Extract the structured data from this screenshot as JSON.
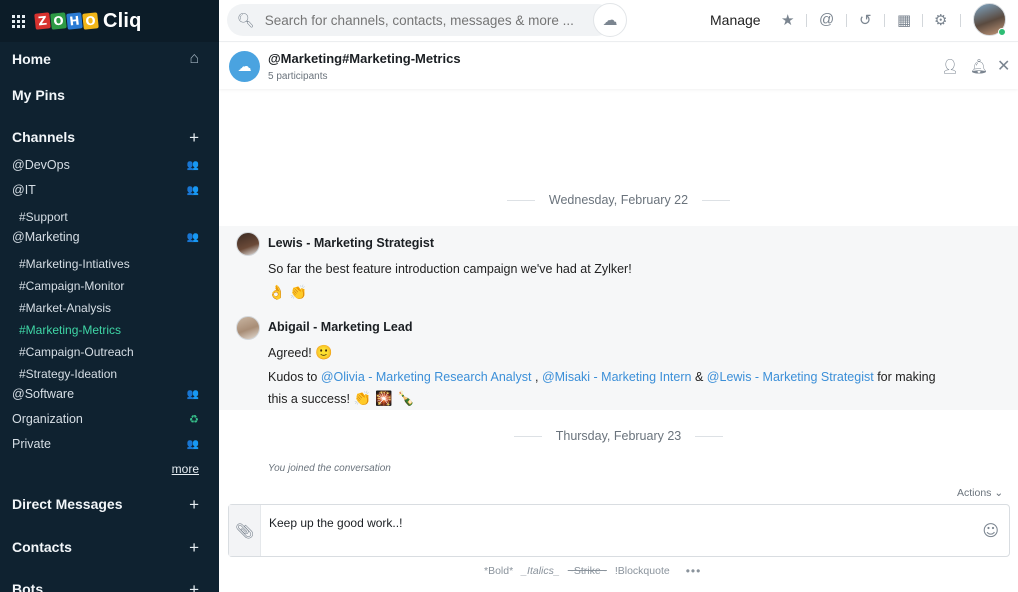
{
  "brand": {
    "letters": [
      "Z",
      "O",
      "H",
      "O"
    ],
    "letter_colors": [
      "#d8322f",
      "#2e9a45",
      "#2a7bd4",
      "#f2b619"
    ],
    "product": "Cliq"
  },
  "sidebar": {
    "home": "Home",
    "pins": "My Pins",
    "channels_title": "Channels",
    "channels": [
      {
        "label": "@DevOps",
        "icon": "group-icon"
      },
      {
        "label": "@IT",
        "icon": "group-icon"
      },
      {
        "label": "#Support",
        "sub": true
      },
      {
        "label": "@Marketing",
        "icon": "group-icon"
      },
      {
        "label": "#Marketing-Intiatives",
        "sub": true
      },
      {
        "label": "#Campaign-Monitor",
        "sub": true
      },
      {
        "label": "#Market-Analysis",
        "sub": true
      },
      {
        "label": "#Marketing-Metrics",
        "sub": true,
        "active": true
      },
      {
        "label": "#Campaign-Outreach",
        "sub": true
      },
      {
        "label": "#Strategy-Ideation",
        "sub": true
      },
      {
        "label": "@Software",
        "icon": "group-icon"
      },
      {
        "label": "Organization",
        "icon": "org-icon"
      },
      {
        "label": "Private",
        "icon": "group-icon"
      }
    ],
    "more": "more",
    "direct_messages": "Direct Messages",
    "contacts": "Contacts",
    "bots": "Bots"
  },
  "topbar": {
    "search_placeholder": "Search for channels, contacts, messages & more ...",
    "manage": "Manage"
  },
  "channel": {
    "name": "@Marketing#Marketing-Metrics",
    "participants": "5 participants"
  },
  "conversation": {
    "date1": "Wednesday, February 22",
    "msg1": {
      "author": "Lewis - Marketing Strategist",
      "text": "So far the best feature introduction campaign we've had at Zylker!",
      "reactions": "👌 👏"
    },
    "msg2": {
      "author": "Abigail - Marketing Lead",
      "line1": "Agreed!",
      "line1_emoji": "🙂",
      "kudos": "Kudos to",
      "mention1": "@Olivia - Marketing Research Analyst",
      "mention2": "@Misaki - Marketing Intern",
      "amp": "&",
      "mention3": "@Lewis - Marketing Strategist",
      "for_making": "for making",
      "line3": "this a success!",
      "line3_emoji": "👏 🎇 🍾"
    },
    "date2": "Thursday, February 23",
    "joined": "You joined the conversation"
  },
  "composer": {
    "actions": "Actions",
    "text": "Keep up the good work..!",
    "format": {
      "bold": "*Bold*",
      "italic": "_Italics_",
      "strike": "~Strike~",
      "quote": "!Blockquote",
      "more": "•••"
    }
  },
  "colors": {
    "sidebar_bg": "#0f2230",
    "active_channel": "#3fd6a6",
    "mention": "#3b8fd8",
    "presence": "#2dbd74"
  }
}
